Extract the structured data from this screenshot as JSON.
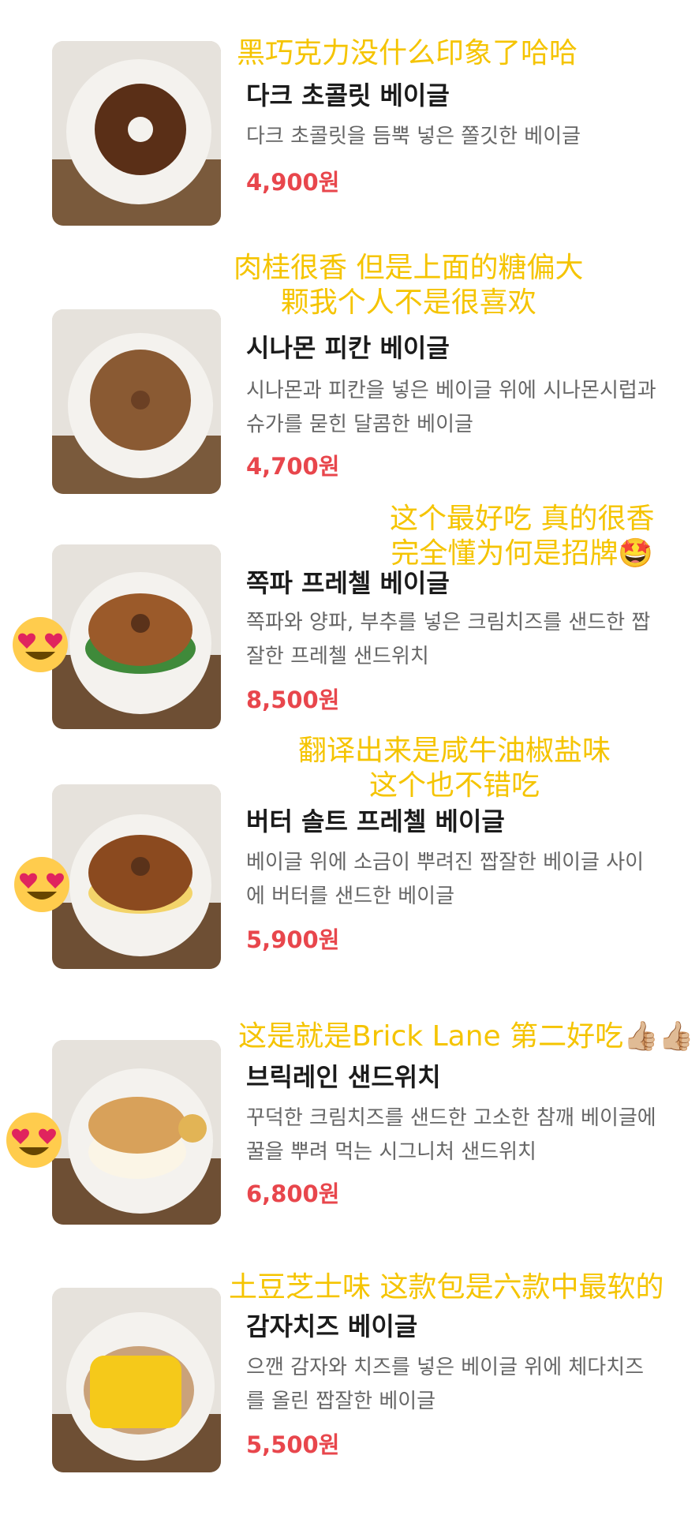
{
  "menu": [
    {
      "note_lines": [
        "黑巧克力没什么印象了哈哈"
      ],
      "name": "다크 초콜릿 베이글",
      "desc": "다크 초콜릿을 듬뿍 넣은 쫄깃한 베이글",
      "price": "4,900원",
      "has_heart_eyes": false
    },
    {
      "note_lines": [
        "肉桂很香 但是上面的糖偏大",
        "颗我个人不是很喜欢"
      ],
      "name": "시나몬 피칸 베이글",
      "desc": "시나몬과 피칸을 넣은 베이글 위에 시나몬시럽과 슈가를 묻힌 달콤한 베이글",
      "price": "4,700원",
      "has_heart_eyes": false
    },
    {
      "note_lines": [
        "这个最好吃 真的很香",
        "完全懂为何是招牌🤩"
      ],
      "name": "쪽파 프레첼 베이글",
      "desc": "쪽파와 양파, 부추를 넣은 크림치즈를 샌드한 짭잘한 프레첼 샌드위치",
      "price": "8,500원",
      "has_heart_eyes": true
    },
    {
      "note_lines": [
        "翻译出来是咸牛油椒盐味",
        "这个也不错吃"
      ],
      "name": "버터 솔트 프레첼 베이글",
      "desc": "베이글 위에 소금이 뿌려진 짭잘한 베이글 사이에 버터를 샌드한 베이글",
      "price": "5,900원",
      "has_heart_eyes": true
    },
    {
      "note_lines": [
        "这是就是Brick Lane 第二好吃👍🏼👍🏼"
      ],
      "name": "브릭레인 샌드위치",
      "desc": "꾸덕한 크림치즈를 샌드한 고소한 참깨 베이글에 꿀을 뿌려 먹는 시그니처 샌드위치",
      "price": "6,800원",
      "has_heart_eyes": true
    },
    {
      "note_lines": [
        "土豆芝士味 这款包是六款中最软的"
      ],
      "name": "감자치즈 베이글",
      "desc": "으깬 감자와 치즈를 넣은 베이글 위에 체다치즈를 올린 짭잘한 베이글",
      "price": "5,500원",
      "has_heart_eyes": false
    }
  ],
  "colors": {
    "note": "#f5c400",
    "price": "#e8464c",
    "name": "#1b1b1b",
    "desc": "#666666"
  },
  "icons": {
    "photo": "bagel-photo",
    "heart_eyes": "heart-eyes-emoji-icon"
  }
}
